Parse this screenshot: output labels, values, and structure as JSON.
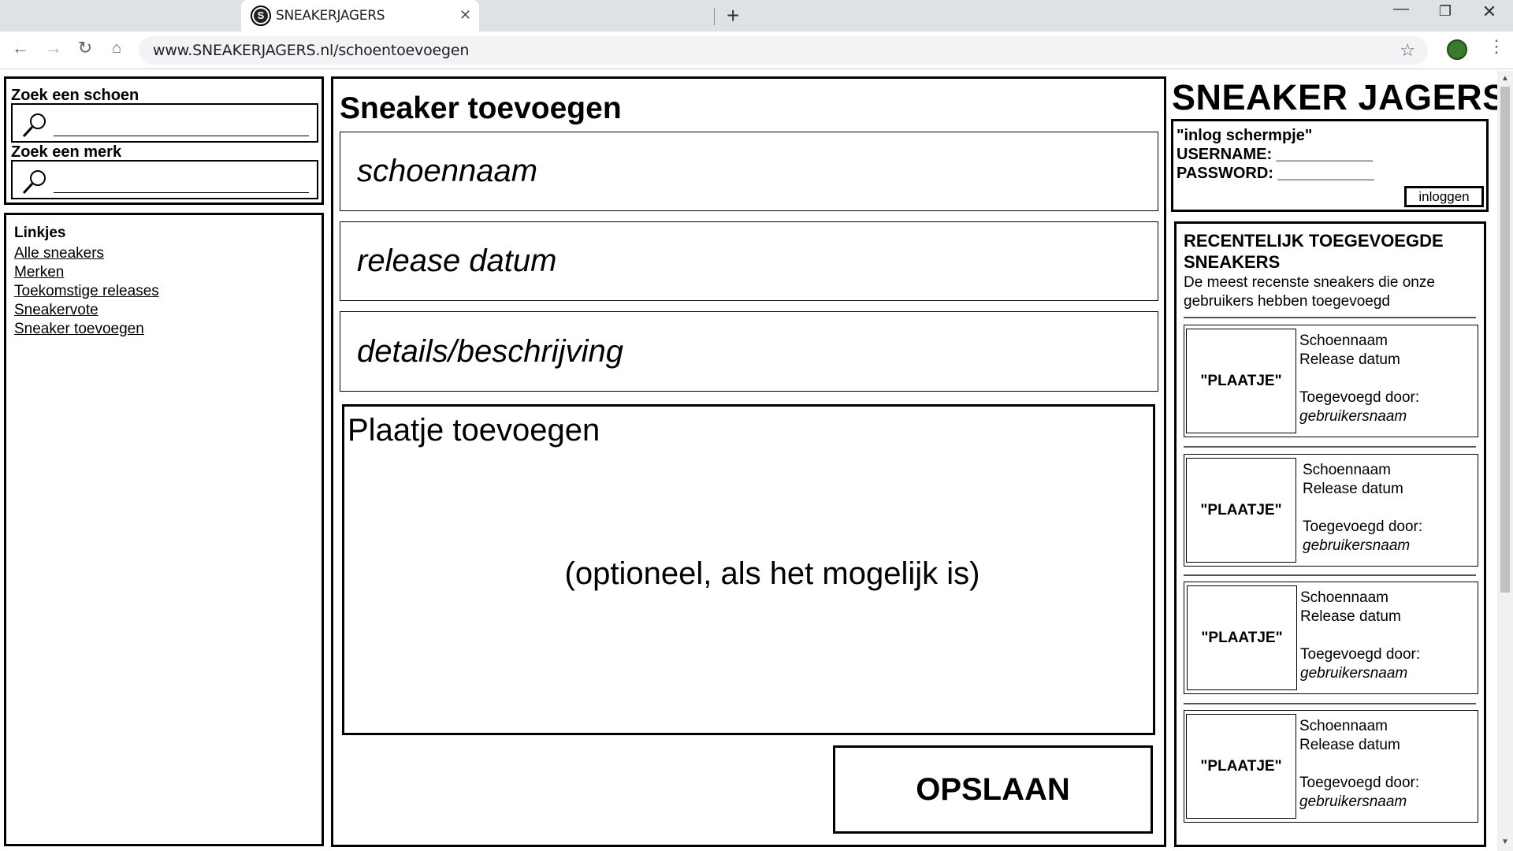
{
  "browser": {
    "tab_title": "SNEAKERJAGERS",
    "url": "www.SNEAKERJAGERS.nl/schoentoevoegen"
  },
  "search": {
    "shoe_label": "Zoek een schoen",
    "brand_label": "Zoek een merk"
  },
  "links": {
    "title": "Linkjes",
    "items": [
      "Alle sneakers",
      "Merken",
      "Toekomstige releases",
      "Sneakervote",
      "Sneaker toevoegen"
    ]
  },
  "main": {
    "title": "Sneaker toevoegen",
    "fields": [
      "schoennaam",
      "release datum",
      "details/beschrijving"
    ],
    "image_title": "Plaatje toevoegen",
    "image_note": "(optioneel, als het mogelijk is)",
    "save_label": "OPSLAAN"
  },
  "brand": "SNEAKER JAGERS",
  "login": {
    "title": "\"inlog schermpje\"",
    "username": "USERNAME: ___________",
    "password": "PASSWORD: ___________",
    "button": "inloggen"
  },
  "recent": {
    "title": "RECENTELIJK TOEGEVOEGDE SNEAKERS",
    "description": "De meest recenste sneakers die onze gebruikers hebben toegevoegd",
    "cards": [
      {
        "image": "\"PLAATJE\"",
        "name": "Schoennaam",
        "release": "Release datum",
        "added_by": "Toegevoegd door:",
        "user": "gebruikersnaam"
      },
      {
        "image": "\"PLAATJE\"",
        "name": "Schoennaam",
        "release": "Release datum",
        "added_by": "Toegevoegd door:",
        "user": "gebruikersnaam"
      },
      {
        "image": "\"PLAATJE\"",
        "name": "Schoennaam",
        "release": "Release datum",
        "added_by": "Toegevoegd door:",
        "user": "gebruikersnaam"
      },
      {
        "image": "\"PLAATJE\"",
        "name": "Schoennaam",
        "release": "Release datum",
        "added_by": "Toegevoegd door:",
        "user": "gebruikersnaam"
      }
    ]
  }
}
